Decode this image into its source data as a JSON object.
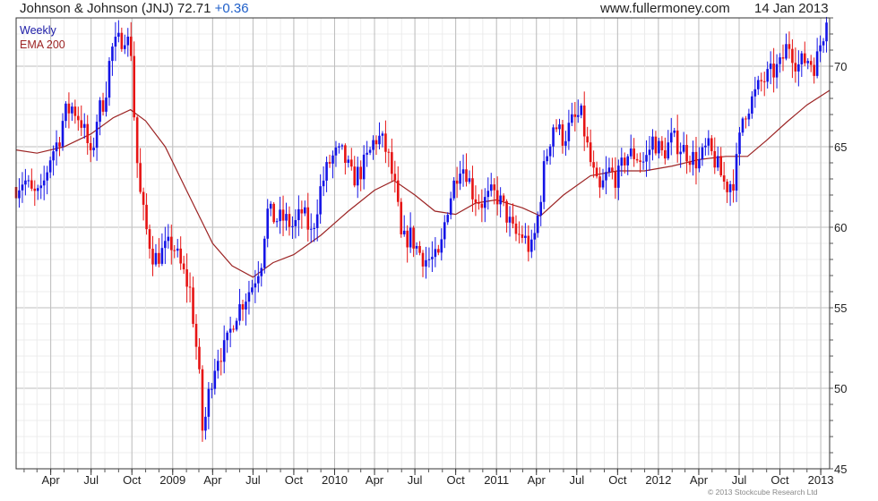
{
  "header": {
    "title_main": "Johnson & Johnson (JNJ) 72.71",
    "title_change": "+0.36",
    "site": "www.fullermoney.com",
    "date": "14 Jan 2013"
  },
  "legend": {
    "weekly": "Weekly",
    "ema": "EMA 200"
  },
  "copyright": "© 2013 Stockcube Research Ltd",
  "colors": {
    "up": "#1414e6",
    "down": "#e61414",
    "ema": "#9c2424",
    "grid": "#d9d9d9",
    "frame": "#333333"
  },
  "chart_data": {
    "type": "candlestick",
    "title": "Johnson & Johnson (JNJ) 72.71 +0.36",
    "xlabel": "",
    "ylabel": "",
    "ylim": [
      45,
      73
    ],
    "y_ticks": [
      45,
      50,
      55,
      60,
      65,
      70
    ],
    "y_axis_position": "right",
    "x_ticks": [
      {
        "label": "Apr",
        "date": "2008-04-01"
      },
      {
        "label": "Jul",
        "date": "2008-07-01"
      },
      {
        "label": "Oct",
        "date": "2008-10-01"
      },
      {
        "label": "2009",
        "date": "2009-01-01"
      },
      {
        "label": "Apr",
        "date": "2009-04-01"
      },
      {
        "label": "Jul",
        "date": "2009-07-01"
      },
      {
        "label": "Oct",
        "date": "2009-10-01"
      },
      {
        "label": "2010",
        "date": "2010-01-01"
      },
      {
        "label": "Apr",
        "date": "2010-04-01"
      },
      {
        "label": "Jul",
        "date": "2010-07-01"
      },
      {
        "label": "Oct",
        "date": "2010-10-01"
      },
      {
        "label": "2011",
        "date": "2011-01-01"
      },
      {
        "label": "Apr",
        "date": "2011-04-01"
      },
      {
        "label": "Jul",
        "date": "2011-07-01"
      },
      {
        "label": "Oct",
        "date": "2011-10-01"
      },
      {
        "label": "2012",
        "date": "2012-01-01"
      },
      {
        "label": "Apr",
        "date": "2012-04-01"
      },
      {
        "label": "Jul",
        "date": "2012-07-01"
      },
      {
        "label": "Oct",
        "date": "2012-10-01"
      },
      {
        "label": "2013",
        "date": "2013-01-01"
      }
    ],
    "x_range": [
      "2008-01-14",
      "2013-01-21"
    ],
    "series": [
      {
        "name": "Weekly",
        "style": "candlestick",
        "points": [
          {
            "x": "2008-01-14",
            "close": 62.5
          },
          {
            "x": "2008-02-01",
            "close": 63.0
          },
          {
            "x": "2008-02-20",
            "close": 62.0
          },
          {
            "x": "2008-03-10",
            "close": 62.0
          },
          {
            "x": "2008-04-01",
            "close": 64.5
          },
          {
            "x": "2008-04-20",
            "close": 65.5
          },
          {
            "x": "2008-05-01",
            "close": 67.0
          },
          {
            "x": "2008-05-20",
            "close": 67.5
          },
          {
            "x": "2008-06-10",
            "close": 66.5
          },
          {
            "x": "2008-06-25",
            "close": 65.0
          },
          {
            "x": "2008-07-01",
            "close": 64.0
          },
          {
            "x": "2008-07-15",
            "close": 67.0
          },
          {
            "x": "2008-08-01",
            "close": 68.0
          },
          {
            "x": "2008-08-15",
            "close": 71.0
          },
          {
            "x": "2008-09-01",
            "close": 71.5
          },
          {
            "x": "2008-09-15",
            "close": 72.0
          },
          {
            "x": "2008-09-29",
            "close": 71.0
          },
          {
            "x": "2008-10-06",
            "close": 67.0
          },
          {
            "x": "2008-10-13",
            "close": 64.0
          },
          {
            "x": "2008-10-20",
            "close": 62.0
          },
          {
            "x": "2008-11-01",
            "close": 60.0
          },
          {
            "x": "2008-11-20",
            "close": 58.0
          },
          {
            "x": "2008-12-10",
            "close": 58.5
          },
          {
            "x": "2009-01-01",
            "close": 59.0
          },
          {
            "x": "2009-01-20",
            "close": 57.5
          },
          {
            "x": "2009-02-10",
            "close": 56.0
          },
          {
            "x": "2009-03-01",
            "close": 51.0
          },
          {
            "x": "2009-03-10",
            "close": 47.0
          },
          {
            "x": "2009-03-25",
            "close": 50.0
          },
          {
            "x": "2009-04-10",
            "close": 52.0
          },
          {
            "x": "2009-05-01",
            "close": 52.5
          },
          {
            "x": "2009-05-20",
            "close": 54.5
          },
          {
            "x": "2009-06-10",
            "close": 55.5
          },
          {
            "x": "2009-07-01",
            "close": 56.5
          },
          {
            "x": "2009-07-20",
            "close": 58.0
          },
          {
            "x": "2009-08-01",
            "close": 61.0
          },
          {
            "x": "2009-08-20",
            "close": 60.5
          },
          {
            "x": "2009-09-10",
            "close": 60.5
          },
          {
            "x": "2009-10-01",
            "close": 60.0
          },
          {
            "x": "2009-10-20",
            "close": 61.0
          },
          {
            "x": "2009-11-10",
            "close": 59.5
          },
          {
            "x": "2009-12-01",
            "close": 62.5
          },
          {
            "x": "2009-12-20",
            "close": 64.0
          },
          {
            "x": "2010-01-01",
            "close": 64.5
          },
          {
            "x": "2010-01-20",
            "close": 64.5
          },
          {
            "x": "2010-02-10",
            "close": 63.0
          },
          {
            "x": "2010-03-01",
            "close": 63.5
          },
          {
            "x": "2010-03-20",
            "close": 64.5
          },
          {
            "x": "2010-04-01",
            "close": 65.5
          },
          {
            "x": "2010-04-15",
            "close": 65.5
          },
          {
            "x": "2010-05-01",
            "close": 64.5
          },
          {
            "x": "2010-05-20",
            "close": 62.0
          },
          {
            "x": "2010-06-01",
            "close": 59.0
          },
          {
            "x": "2010-06-20",
            "close": 59.5
          },
          {
            "x": "2010-07-10",
            "close": 58.5
          },
          {
            "x": "2010-07-25",
            "close": 58.0
          },
          {
            "x": "2010-08-10",
            "close": 58.0
          },
          {
            "x": "2010-08-25",
            "close": 58.0
          },
          {
            "x": "2010-09-10",
            "close": 61.0
          },
          {
            "x": "2010-09-25",
            "close": 62.5
          },
          {
            "x": "2010-10-10",
            "close": 64.0
          },
          {
            "x": "2010-10-25",
            "close": 63.5
          },
          {
            "x": "2010-11-10",
            "close": 62.0
          },
          {
            "x": "2010-12-01",
            "close": 61.5
          },
          {
            "x": "2010-12-20",
            "close": 62.0
          },
          {
            "x": "2011-01-01",
            "close": 62.0
          },
          {
            "x": "2011-01-20",
            "close": 61.0
          },
          {
            "x": "2011-02-10",
            "close": 59.5
          },
          {
            "x": "2011-03-01",
            "close": 59.5
          },
          {
            "x": "2011-03-20",
            "close": 58.5
          },
          {
            "x": "2011-04-01",
            "close": 60.0
          },
          {
            "x": "2011-04-20",
            "close": 64.0
          },
          {
            "x": "2011-05-10",
            "close": 66.5
          },
          {
            "x": "2011-06-01",
            "close": 65.5
          },
          {
            "x": "2011-06-20",
            "close": 66.5
          },
          {
            "x": "2011-07-10",
            "close": 67.0
          },
          {
            "x": "2011-08-01",
            "close": 64.0
          },
          {
            "x": "2011-08-20",
            "close": 62.0
          },
          {
            "x": "2011-09-10",
            "close": 63.5
          },
          {
            "x": "2011-10-01",
            "close": 63.0
          },
          {
            "x": "2011-10-20",
            "close": 64.5
          },
          {
            "x": "2011-11-10",
            "close": 64.5
          },
          {
            "x": "2011-12-01",
            "close": 64.0
          },
          {
            "x": "2011-12-20",
            "close": 65.5
          },
          {
            "x": "2012-01-10",
            "close": 64.5
          },
          {
            "x": "2012-02-01",
            "close": 65.5
          },
          {
            "x": "2012-02-20",
            "close": 65.0
          },
          {
            "x": "2012-03-10",
            "close": 64.5
          },
          {
            "x": "2012-04-01",
            "close": 64.0
          },
          {
            "x": "2012-04-20",
            "close": 65.0
          },
          {
            "x": "2012-05-10",
            "close": 64.0
          },
          {
            "x": "2012-06-01",
            "close": 62.5
          },
          {
            "x": "2012-06-20",
            "close": 63.0
          },
          {
            "x": "2012-07-10",
            "close": 67.0
          },
          {
            "x": "2012-08-01",
            "close": 68.0
          },
          {
            "x": "2012-08-20",
            "close": 69.0
          },
          {
            "x": "2012-09-10",
            "close": 69.5
          },
          {
            "x": "2012-10-01",
            "close": 70.0
          },
          {
            "x": "2012-10-20",
            "close": 71.5
          },
          {
            "x": "2012-11-10",
            "close": 70.0
          },
          {
            "x": "2012-12-01",
            "close": 70.5
          },
          {
            "x": "2012-12-20",
            "close": 70.0
          },
          {
            "x": "2013-01-01",
            "close": 71.5
          },
          {
            "x": "2013-01-14",
            "close": 72.71
          }
        ]
      },
      {
        "name": "EMA 200",
        "style": "line",
        "points": [
          {
            "x": "2008-01-14",
            "y": 64.8
          },
          {
            "x": "2008-03-01",
            "y": 64.6
          },
          {
            "x": "2008-05-01",
            "y": 65.0
          },
          {
            "x": "2008-07-01",
            "y": 65.8
          },
          {
            "x": "2008-08-20",
            "y": 66.8
          },
          {
            "x": "2008-09-28",
            "y": 67.3
          },
          {
            "x": "2008-11-01",
            "y": 66.6
          },
          {
            "x": "2008-12-15",
            "y": 65.0
          },
          {
            "x": "2009-02-01",
            "y": 62.3
          },
          {
            "x": "2009-04-01",
            "y": 59.0
          },
          {
            "x": "2009-05-15",
            "y": 57.6
          },
          {
            "x": "2009-07-01",
            "y": 56.9
          },
          {
            "x": "2009-08-15",
            "y": 57.8
          },
          {
            "x": "2009-10-01",
            "y": 58.3
          },
          {
            "x": "2009-12-01",
            "y": 59.5
          },
          {
            "x": "2010-02-01",
            "y": 61.0
          },
          {
            "x": "2010-04-01",
            "y": 62.3
          },
          {
            "x": "2010-05-15",
            "y": 62.9
          },
          {
            "x": "2010-07-01",
            "y": 62.0
          },
          {
            "x": "2010-08-15",
            "y": 61.0
          },
          {
            "x": "2010-10-01",
            "y": 60.8
          },
          {
            "x": "2010-11-15",
            "y": 61.5
          },
          {
            "x": "2011-01-01",
            "y": 61.7
          },
          {
            "x": "2011-03-01",
            "y": 61.2
          },
          {
            "x": "2011-04-10",
            "y": 60.7
          },
          {
            "x": "2011-06-01",
            "y": 62.0
          },
          {
            "x": "2011-08-01",
            "y": 63.2
          },
          {
            "x": "2011-10-01",
            "y": 63.5
          },
          {
            "x": "2011-12-01",
            "y": 63.5
          },
          {
            "x": "2012-02-01",
            "y": 63.8
          },
          {
            "x": "2012-04-01",
            "y": 64.2
          },
          {
            "x": "2012-06-01",
            "y": 64.4
          },
          {
            "x": "2012-07-20",
            "y": 64.4
          },
          {
            "x": "2012-09-01",
            "y": 65.4
          },
          {
            "x": "2012-10-15",
            "y": 66.5
          },
          {
            "x": "2012-12-01",
            "y": 67.6
          },
          {
            "x": "2013-01-21",
            "y": 68.5
          }
        ]
      }
    ],
    "grid": true,
    "legend_position": "top-left"
  }
}
